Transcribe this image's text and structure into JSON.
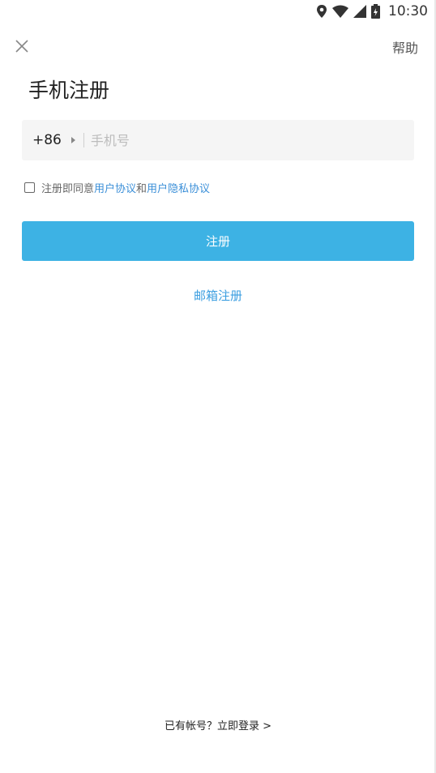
{
  "status_bar": {
    "time": "10:30",
    "icons": [
      "location-icon",
      "wifi-icon",
      "signal-icon",
      "battery-icon"
    ]
  },
  "header": {
    "close_icon": "close-icon",
    "help_label": "帮助"
  },
  "page": {
    "title": "手机注册"
  },
  "phone": {
    "country_code": "+86",
    "placeholder": "手机号",
    "value": ""
  },
  "agreement": {
    "prefix": "注册即同意",
    "user_agreement": "用户协议",
    "and": "和",
    "privacy_agreement": "用户隐私协议",
    "checked": false
  },
  "actions": {
    "register_label": "注册",
    "email_register_label": "邮箱注册",
    "login_prompt": "已有帐号？立即登录 >"
  },
  "colors": {
    "primary": "#3db2e4",
    "link": "#3b8fd8"
  }
}
